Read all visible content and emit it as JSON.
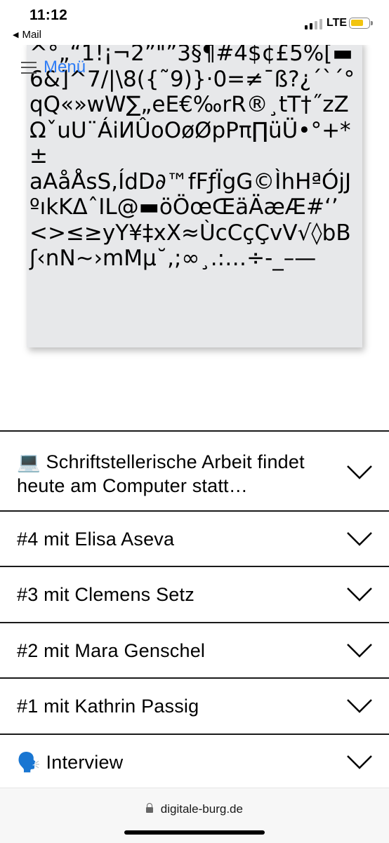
{
  "status_bar": {
    "time": "11:12",
    "back_app": "Mail",
    "network": "LTE"
  },
  "menu": {
    "label": "Menü"
  },
  "glyph_card": {
    "text": "^°„“1!¡¬2”\"”3§¶#4$¢£5%[▬6&]^7/|\\8({˜9)}·0=≠¯ß?¿´`´°qQ«»wW∑„eE€‰rR®¸tT†˝zZΩˇuU¨ÁiИÛoOøØpPπ∏üÜ•°+*±\naAåÅsS,ÍdD∂™fFƒÏgG©ÌhHªÓjJºıkKΔˆIL@▬öÖœŒäÄæÆ#‘’\n<>≤≥yY¥‡xX≈ÙcCçÇvV√◊bBʃ‹nN~›mMµ˘,;∞¸.:…÷-_–—"
  },
  "accordion": [
    {
      "icon": "💻",
      "label": "Schriftstellerische Arbeit findet heute am Computer statt…"
    },
    {
      "label": "#4 mit Elisa Aseva"
    },
    {
      "label": "#3 mit Clemens Setz"
    },
    {
      "label": "#2 mit Mara Genschel"
    },
    {
      "label": "#1 mit Kathrin Passig"
    },
    {
      "icon": "🗣️",
      "label": "Interview"
    }
  ],
  "browser": {
    "url": "digitale-burg.de"
  }
}
